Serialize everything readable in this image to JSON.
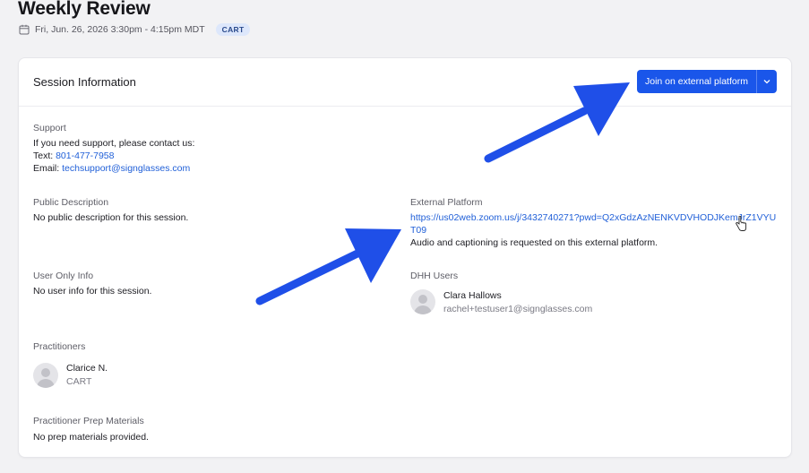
{
  "header": {
    "title": "Weekly Review",
    "date": "Fri, Jun. 26, 2026 3:30pm - 4:15pm MDT",
    "badge": "CART"
  },
  "card": {
    "title": "Session Information",
    "join_label": "Join on external platform"
  },
  "support": {
    "label": "Support",
    "line1": "If you need support, please contact us:",
    "text_prefix": "Text: ",
    "phone": "801-477-7958",
    "email_prefix": "Email: ",
    "email": "techsupport@signglasses.com"
  },
  "public_description": {
    "label": "Public Description",
    "value": "No public description for this session."
  },
  "external_platform": {
    "label": "External Platform",
    "url_line1": "https://us02web.zoom.us/j/3432740271?pwd=Q2xGdzAzNENKVDVHODJKemJrZ1VYU",
    "url_line2": "T09",
    "note": "Audio and captioning is requested on this external platform."
  },
  "user_only_info": {
    "label": "User Only Info",
    "value": "No user info for this session."
  },
  "dhh_users": {
    "label": "DHH Users",
    "name": "Clara Hallows",
    "email": "rachel+testuser1@signglasses.com"
  },
  "practitioners": {
    "label": "Practitioners",
    "name": "Clarice N.",
    "role": "CART"
  },
  "prep_materials": {
    "label": "Practitioner Prep Materials",
    "value": "No prep materials provided."
  },
  "colors": {
    "accent": "#1a56ea",
    "link": "#2160d8",
    "arrow": "#1f4fe8"
  },
  "icons": {
    "calendar": "calendar-icon",
    "caret": "chevron-down-icon",
    "cursor": "hand-pointer-icon"
  }
}
